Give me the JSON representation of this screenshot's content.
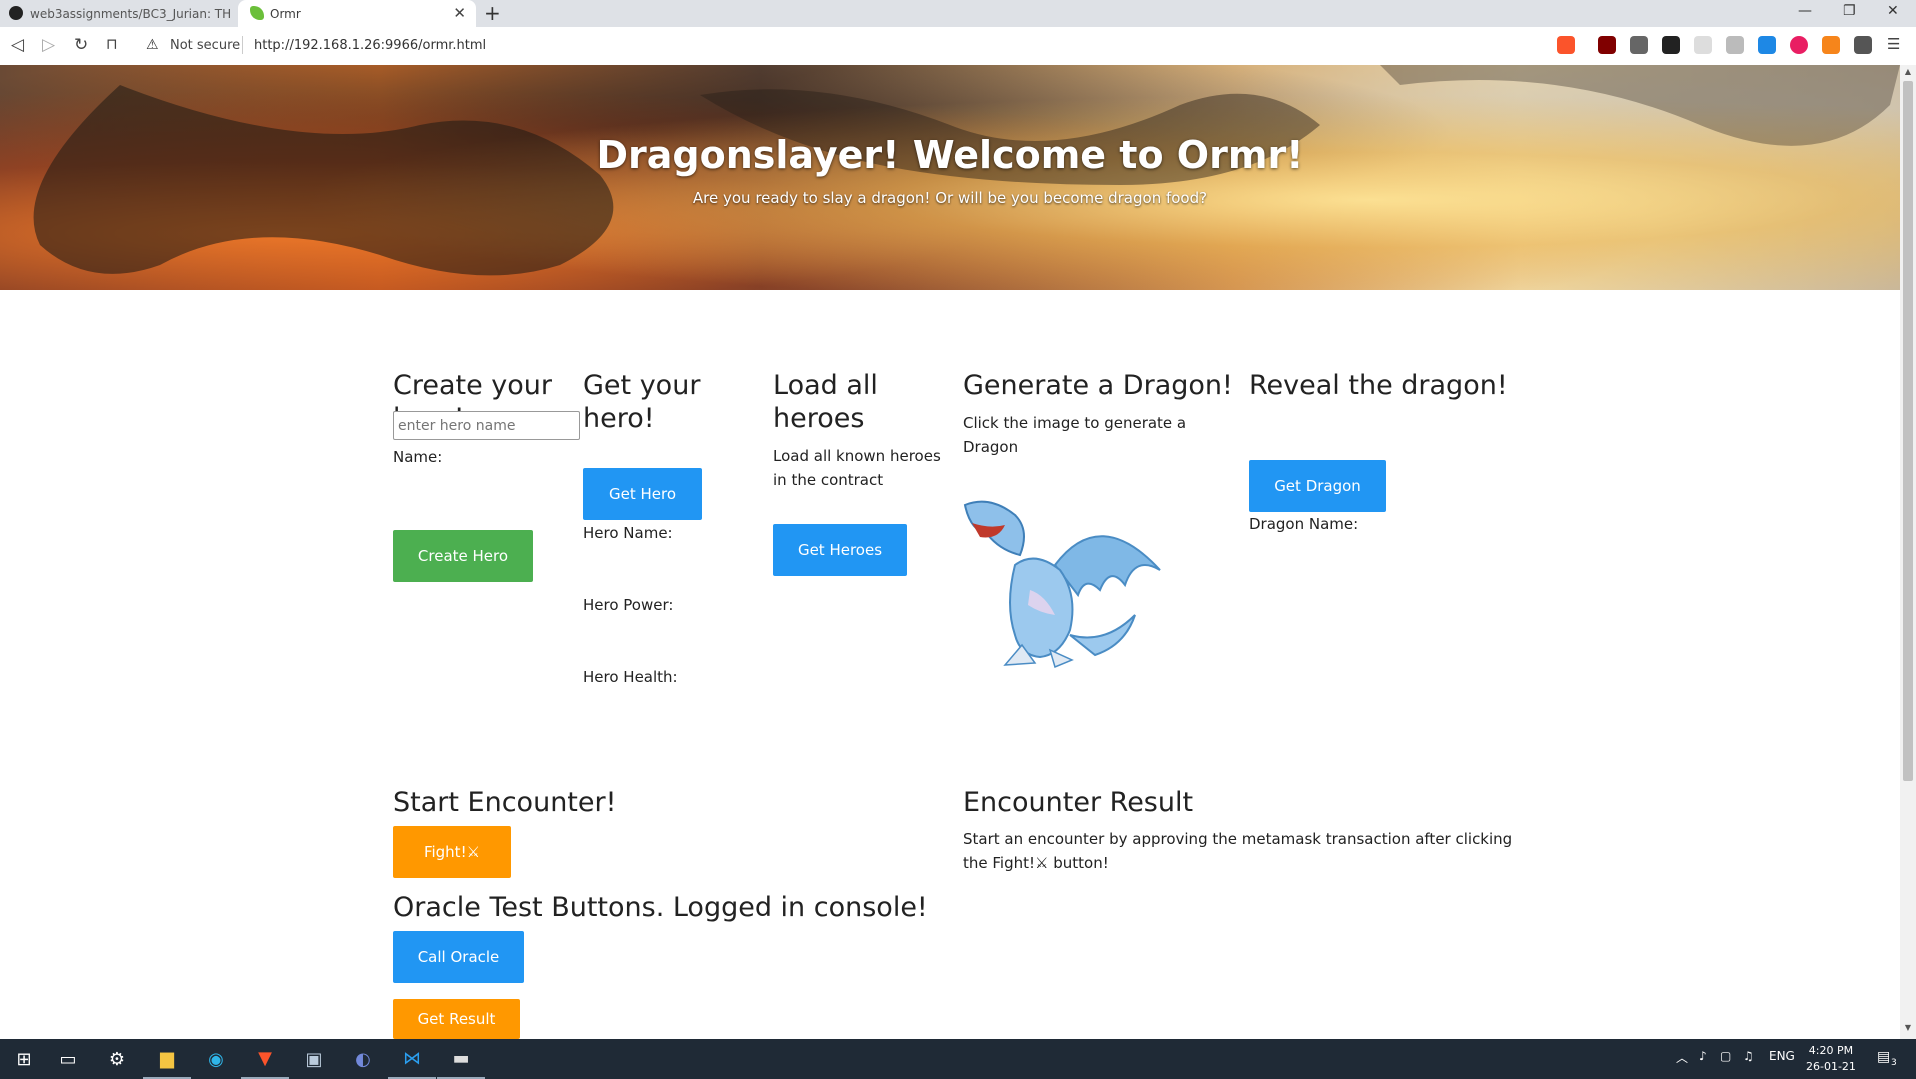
{
  "browser": {
    "tabs": [
      {
        "title": "web3assignments/BC3_Jurian: THUAS",
        "active": false
      },
      {
        "title": "Ormr",
        "active": true
      }
    ],
    "security_label": "Not secure",
    "url": "http://192.168.1.26:9966/ormr.html"
  },
  "hero_banner": {
    "title": "Dragonslayer! Welcome to Ormr!",
    "subtitle": "Are you ready to slay a dragon! Or will be you become dragon food?"
  },
  "create_hero": {
    "heading": "Create your hero!",
    "name_label": "Name:",
    "name_placeholder": "enter hero name",
    "button": "Create Hero"
  },
  "get_hero": {
    "heading": "Get your hero!",
    "button": "Get Hero",
    "name_label": "Hero Name:",
    "power_label": "Hero Power:",
    "health_label": "Hero Health:"
  },
  "load_heroes": {
    "heading": "Load all heroes",
    "description": "Load all known heroes in the contract",
    "button": "Get Heroes"
  },
  "generate_dragon": {
    "heading": "Generate a Dragon!",
    "description": "Click the image to generate a Dragon"
  },
  "reveal_dragon": {
    "heading": "Reveal the dragon!",
    "button": "Get Dragon",
    "name_label": "Dragon Name:"
  },
  "encounter": {
    "heading": "Start Encounter!",
    "button": "Fight!⚔"
  },
  "encounter_result": {
    "heading": "Encounter Result",
    "text": "Start an encounter by approving the metamask transaction after clicking the Fight!⚔ button!"
  },
  "oracle": {
    "heading": "Oracle Test Buttons. Logged in console!",
    "call_button": "Call Oracle",
    "result_button": "Get Result"
  },
  "taskbar": {
    "tray_lang": "ENG",
    "time": "4:20 PM",
    "date": "26-01-21",
    "notifications": "3"
  },
  "colors": {
    "primary": "#2196f3",
    "success": "#4caf50",
    "warning": "#ff9800"
  }
}
